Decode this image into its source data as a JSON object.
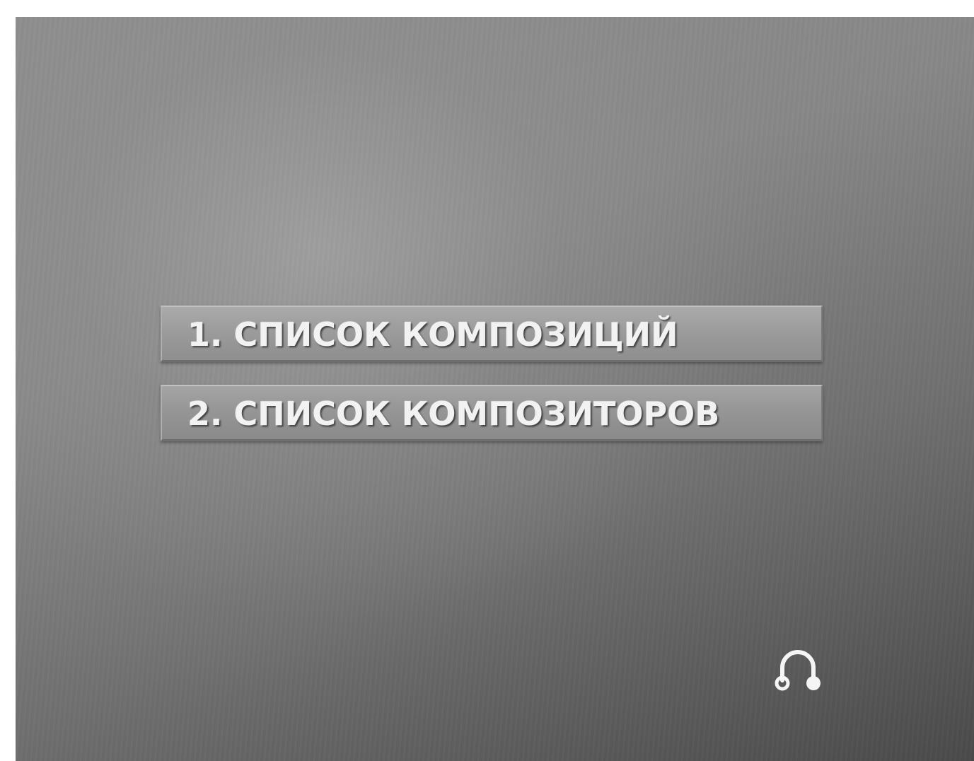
{
  "menu": {
    "items": [
      {
        "label": "1. СПИСОК КОМПОЗИЦИЙ",
        "selected": true
      },
      {
        "label": "2. СПИСОК КОМПОЗИТОРОВ",
        "selected": false
      }
    ]
  },
  "status": {
    "icon": "headphone-icon"
  },
  "colors": {
    "background": "#888888",
    "button": "#9a9a9a",
    "text": "#f2f2f2"
  }
}
